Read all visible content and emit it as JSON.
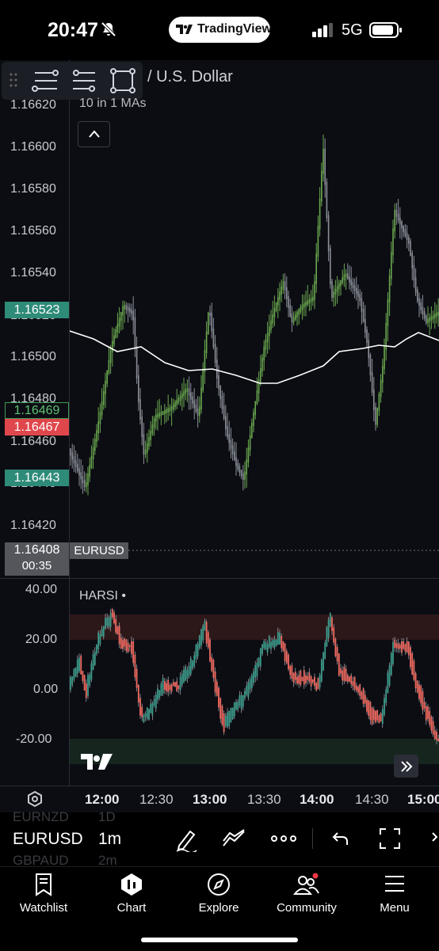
{
  "status": {
    "time": "20:47",
    "app_pill": "TradingView",
    "network": "5G"
  },
  "chart": {
    "pair_title": "/ U.S. Dollar",
    "indicator_label": "10 in 1 MAs",
    "price_ticks": [
      "1.16620",
      "1.16600",
      "1.16580",
      "1.16560",
      "1.16540",
      "1.16520",
      "1.16500",
      "1.16480",
      "1.16460",
      "1.16440",
      "1.16420"
    ],
    "badges": {
      "upper_green": "1.16523",
      "outline_green": "1.16469",
      "red": "1.16467",
      "lower_green": "1.16443",
      "last_price": "1.16408",
      "countdown": "00:35",
      "symbol_tag": "EURUSD"
    },
    "colors": {
      "up": "#6aa84f",
      "down": "#8b8f98",
      "ma": "#ffffff",
      "harsi_up": "#3d9a8b",
      "harsi_down": "#f06b61"
    }
  },
  "harsi": {
    "label": "HARSI •",
    "ticks": [
      "40.00",
      "20.00",
      "0.00",
      "-20.00"
    ]
  },
  "time_axis": [
    {
      "label": "12:00",
      "bold": true
    },
    {
      "label": "12:30",
      "bold": false
    },
    {
      "label": "13:00",
      "bold": true
    },
    {
      "label": "13:30",
      "bold": false
    },
    {
      "label": "14:00",
      "bold": true
    },
    {
      "label": "14:30",
      "bold": false
    },
    {
      "label": "15:00",
      "bold": true
    }
  ],
  "symbol_bar": {
    "ghost_prev_symbol": "EURNZD",
    "ghost_prev_interval": "1D",
    "symbol": "EURUSD",
    "interval": "1m",
    "ghost_next_symbol": "GBPAUD",
    "ghost_next_interval": "2m",
    "icons": [
      "pen-icon",
      "trend-tool-icon",
      "more-icon",
      "undo-icon",
      "fullscreen-icon"
    ]
  },
  "tabs": [
    {
      "label": "Watchlist",
      "icon": "watchlist-icon"
    },
    {
      "label": "Chart",
      "icon": "chart-icon"
    },
    {
      "label": "Explore",
      "icon": "compass-icon"
    },
    {
      "label": "Community",
      "icon": "community-icon"
    },
    {
      "label": "Menu",
      "icon": "menu-icon"
    }
  ]
}
